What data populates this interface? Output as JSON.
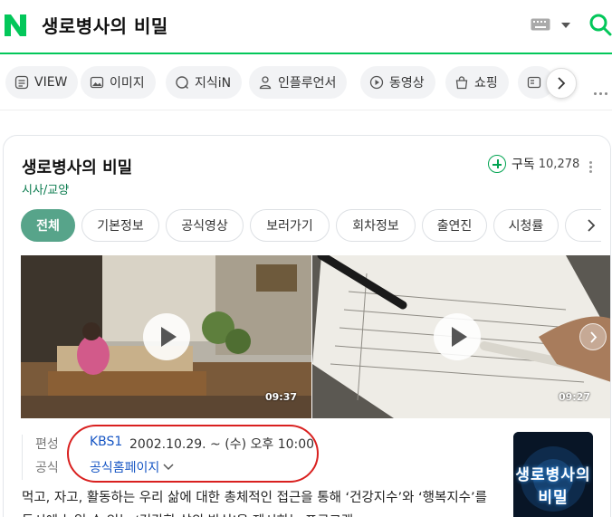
{
  "search": {
    "query": "생로병사의 비밀"
  },
  "header": {
    "logo_icon": "naver-n-logo-icon",
    "keyboard_icon": "keyboard-icon",
    "search_icon": "search-icon"
  },
  "tabs": [
    {
      "label": "VIEW",
      "icon": "view-icon"
    },
    {
      "label": "이미지",
      "icon": "image-icon"
    },
    {
      "label": "지식iN",
      "icon": "knowledge-icon"
    },
    {
      "label": "인플루언서",
      "icon": "person-icon"
    },
    {
      "label": "동영상",
      "icon": "play-circle-icon"
    },
    {
      "label": "쇼핑",
      "icon": "shopping-bag-icon"
    }
  ],
  "program": {
    "title": "생로병사의 비밀",
    "genre": "시사/교양",
    "subscribe_label": "구독",
    "subscriber_count": "10,278",
    "chips": [
      "전체",
      "기본정보",
      "공식영상",
      "보러가기",
      "회차정보",
      "출연진",
      "시청률"
    ],
    "videos": [
      {
        "duration": "09:37"
      },
      {
        "duration": "09:27"
      }
    ],
    "info": {
      "schedule_label": "편성",
      "broadcaster": "KBS1",
      "airtime": "2002.10.29. ~  (수) 오후 10:00",
      "official_label": "공식",
      "homepage_label": "공식홈페이지"
    },
    "poster_text_line1": "생로병사의",
    "poster_text_line2": "비밀",
    "description": "먹고, 자고, 활동하는 우리 삶에 대한 총체적인 접근을 통해 ‘건강지수’와 ‘행복지수’를 동시에 높일 수 있는 ‘건강한 삶의 방식’을 제시하는 프로그램"
  },
  "colors": {
    "brand_green": "#03c75a",
    "chip_active": "#57a48a",
    "link_blue": "#1756c4",
    "annotation_red": "#d9201f"
  }
}
